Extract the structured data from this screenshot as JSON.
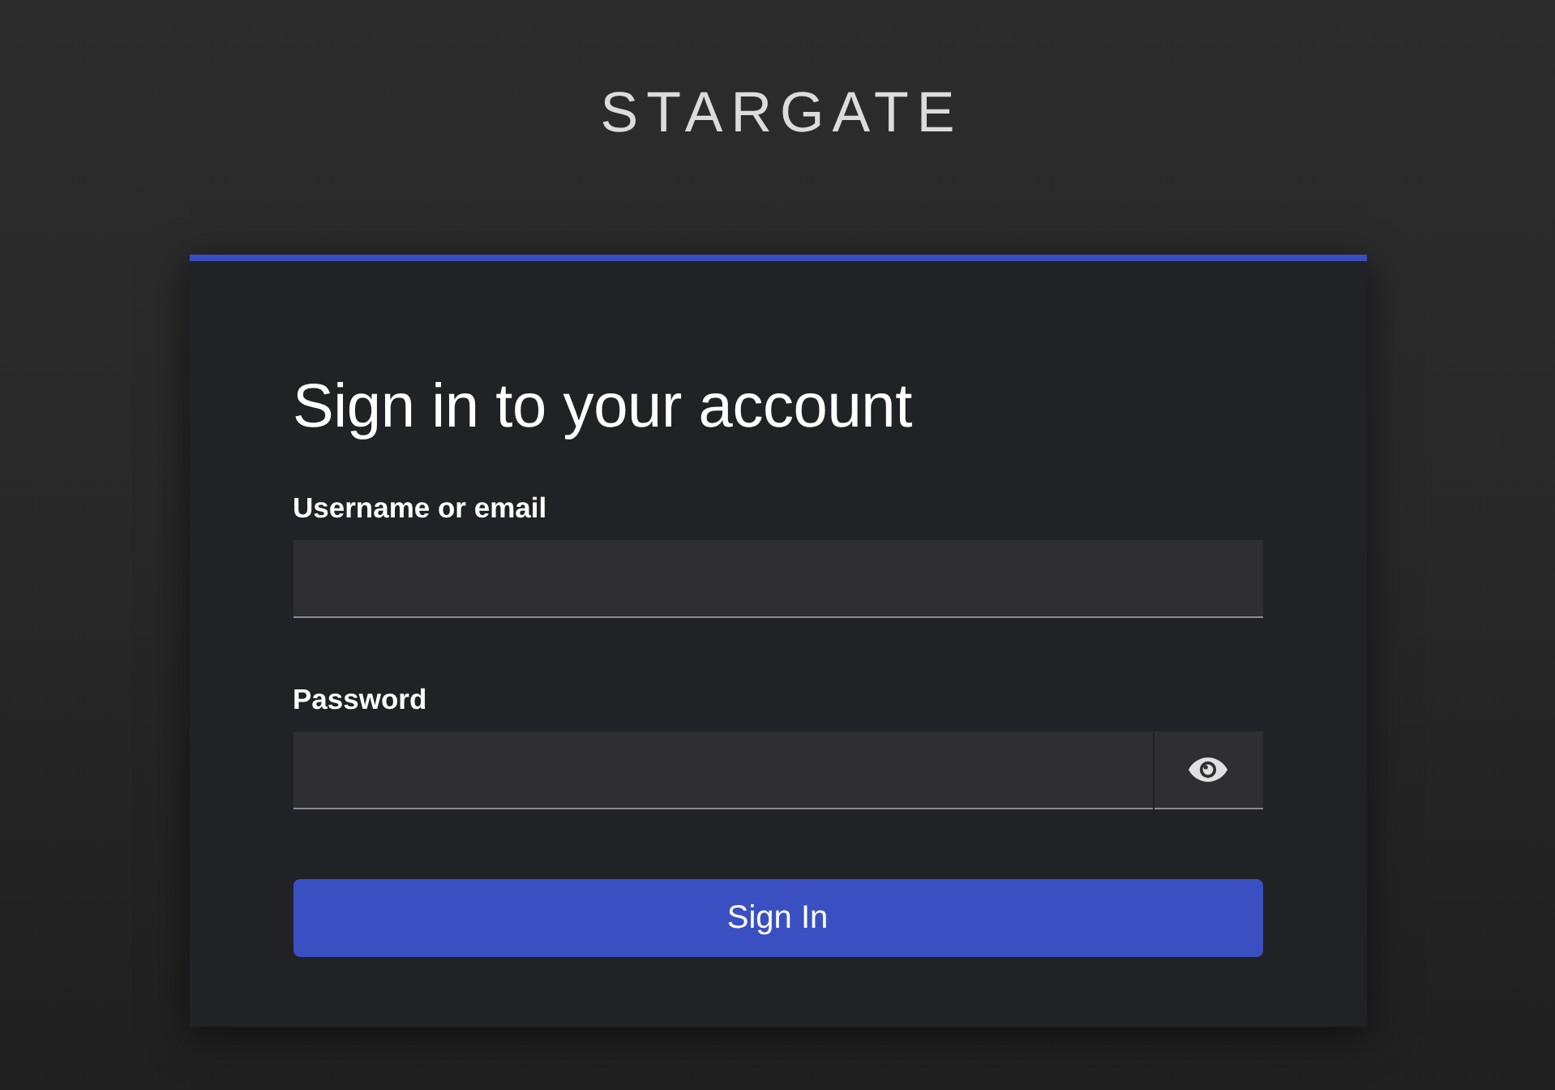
{
  "logo": {
    "text": "STARGATE"
  },
  "card": {
    "title": "Sign in to your account",
    "fields": [
      {
        "kind": "text",
        "label": "Username or email"
      },
      {
        "kind": "password",
        "label": "Password"
      }
    ],
    "submit": {
      "label": "Sign In"
    }
  }
}
